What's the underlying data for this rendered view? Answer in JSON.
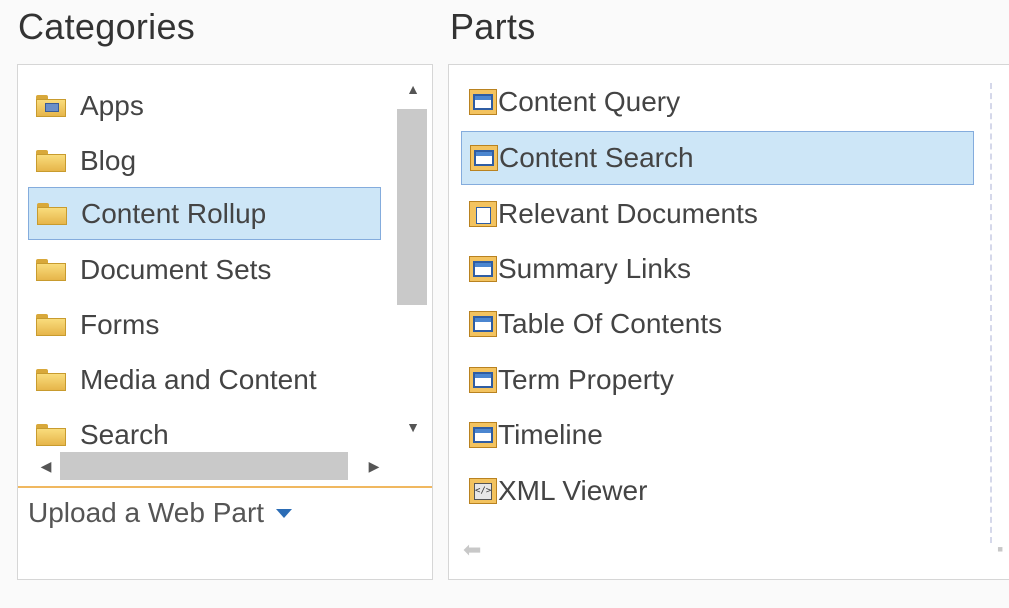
{
  "headings": {
    "categories": "Categories",
    "parts": "Parts"
  },
  "categories": {
    "items": [
      {
        "label": "Apps",
        "icon": "folder-apps-icon"
      },
      {
        "label": "Blog",
        "icon": "folder-icon"
      },
      {
        "label": "Content Rollup",
        "icon": "folder-icon",
        "selected": true
      },
      {
        "label": "Document Sets",
        "icon": "folder-icon"
      },
      {
        "label": "Forms",
        "icon": "folder-icon"
      },
      {
        "label": "Media and Content",
        "icon": "folder-icon"
      },
      {
        "label": "Search",
        "icon": "folder-icon"
      }
    ],
    "upload_label": "Upload a Web Part"
  },
  "parts": {
    "items": [
      {
        "label": "Content Query",
        "icon": "web-part-icon"
      },
      {
        "label": "Content Search",
        "icon": "web-part-icon",
        "selected": true
      },
      {
        "label": "Relevant Documents",
        "icon": "document-web-part-icon"
      },
      {
        "label": "Summary Links",
        "icon": "web-part-icon"
      },
      {
        "label": "Table Of Contents",
        "icon": "web-part-icon"
      },
      {
        "label": "Term Property",
        "icon": "web-part-icon"
      },
      {
        "label": "Timeline",
        "icon": "web-part-icon"
      },
      {
        "label": "XML Viewer",
        "icon": "xml-web-part-icon"
      }
    ]
  },
  "colors": {
    "selection_bg": "#cde6f7",
    "selection_border": "#84acdd",
    "accent_orange": "#f0b860",
    "dropdown_caret": "#2b6cb5"
  }
}
